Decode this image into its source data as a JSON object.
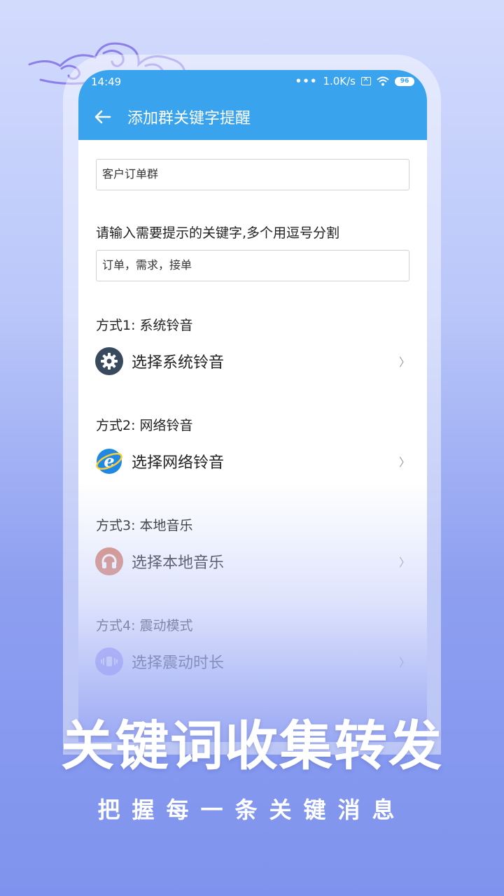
{
  "status_bar": {
    "time": "14:49",
    "dots": "•••",
    "net_speed": "1.0K/s",
    "battery": "96"
  },
  "toolbar": {
    "title": "添加群关键字提醒"
  },
  "form": {
    "group_name_value": "客户订单群",
    "keywords_label": "请输入需要提示的关键字,多个用逗号分割",
    "keywords_value": "订单，需求，接单"
  },
  "options": [
    {
      "header": "方式1: 系统铃音",
      "label": "选择系统铃音",
      "icon": "gear-icon",
      "color": "#3a4a5e"
    },
    {
      "header": "方式2: 网络铃音",
      "label": "选择网络铃音",
      "icon": "internet-explorer-icon",
      "color": "#1a7fd6"
    },
    {
      "header": "方式3: 本地音乐",
      "label": "选择本地音乐",
      "icon": "headphones-icon",
      "color": "#d9826a"
    },
    {
      "header": "方式4: 震动模式",
      "label": "选择震动时长",
      "icon": "vibration-icon",
      "color": "#8c7df0"
    }
  ],
  "chevron": "〉",
  "promo": {
    "headline": "关键词收集转发",
    "subline": "把握每一条关键消息"
  },
  "colors": {
    "accent": "#3aa3ee",
    "background_top": "#d3dbfd",
    "background_bottom": "#7f93ee"
  }
}
